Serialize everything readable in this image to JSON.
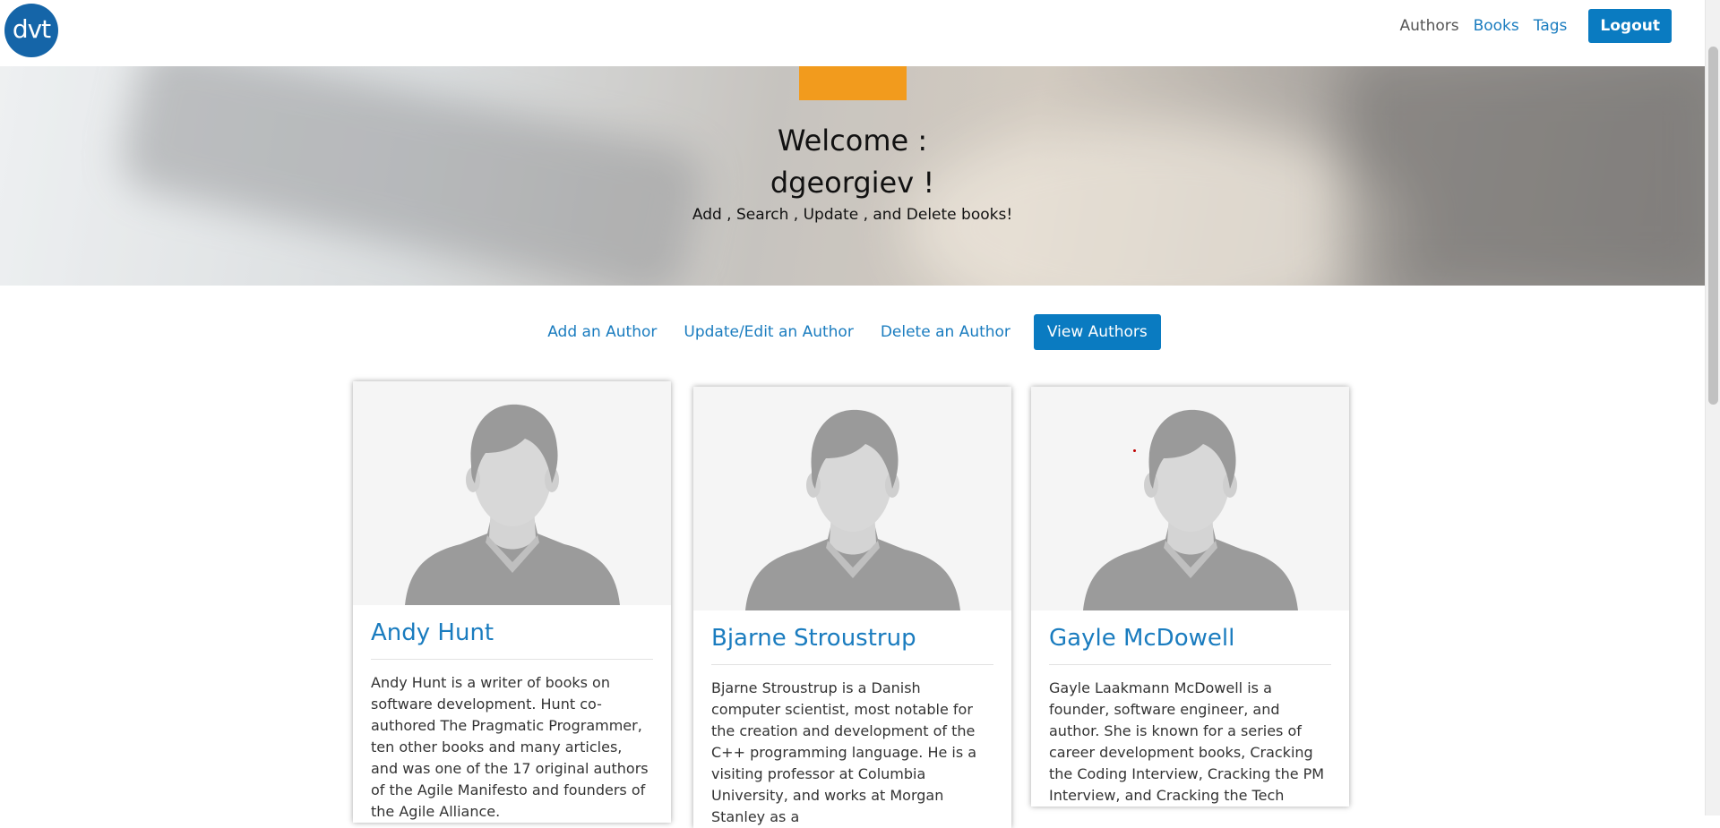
{
  "logo": {
    "text": "dvt"
  },
  "nav": {
    "items": [
      {
        "label": "Authors"
      },
      {
        "label": "Books"
      },
      {
        "label": "Tags"
      }
    ],
    "logout_label": "Logout"
  },
  "hero": {
    "welcome_line1": "Welcome :",
    "welcome_line2": "dgeorgiev !",
    "subtitle": "Add , Search , Update , and Delete books!"
  },
  "actions": {
    "add": "Add an Author",
    "update": "Update/Edit an Author",
    "delete": "Delete an Author",
    "view": "View Authors"
  },
  "authors": [
    {
      "name": "Andy Hunt",
      "description": "Andy Hunt is a writer of books on software development. Hunt co-authored The Pragmatic Programmer, ten other books and many articles, and was one of the 17 original authors of the Agile Manifesto and founders of the Agile Alliance."
    },
    {
      "name": "Bjarne Stroustrup",
      "description": "Bjarne Stroustrup is a Danish computer scientist, most notable for the creation and development of the C++ programming language. He is a visiting professor at Columbia University, and works at Morgan Stanley as a"
    },
    {
      "name": "Gayle McDowell",
      "description": "Gayle Laakmann McDowell is a founder, software engineer, and author. She is known for a series of career development books, Cracking the Coding Interview, Cracking the PM Interview, and Cracking the Tech"
    }
  ],
  "colors": {
    "brand_blue": "#0a7bc1",
    "link_blue": "#1a7cbf",
    "accent_orange": "#f29b1d",
    "logo_blue": "#1565a8"
  }
}
